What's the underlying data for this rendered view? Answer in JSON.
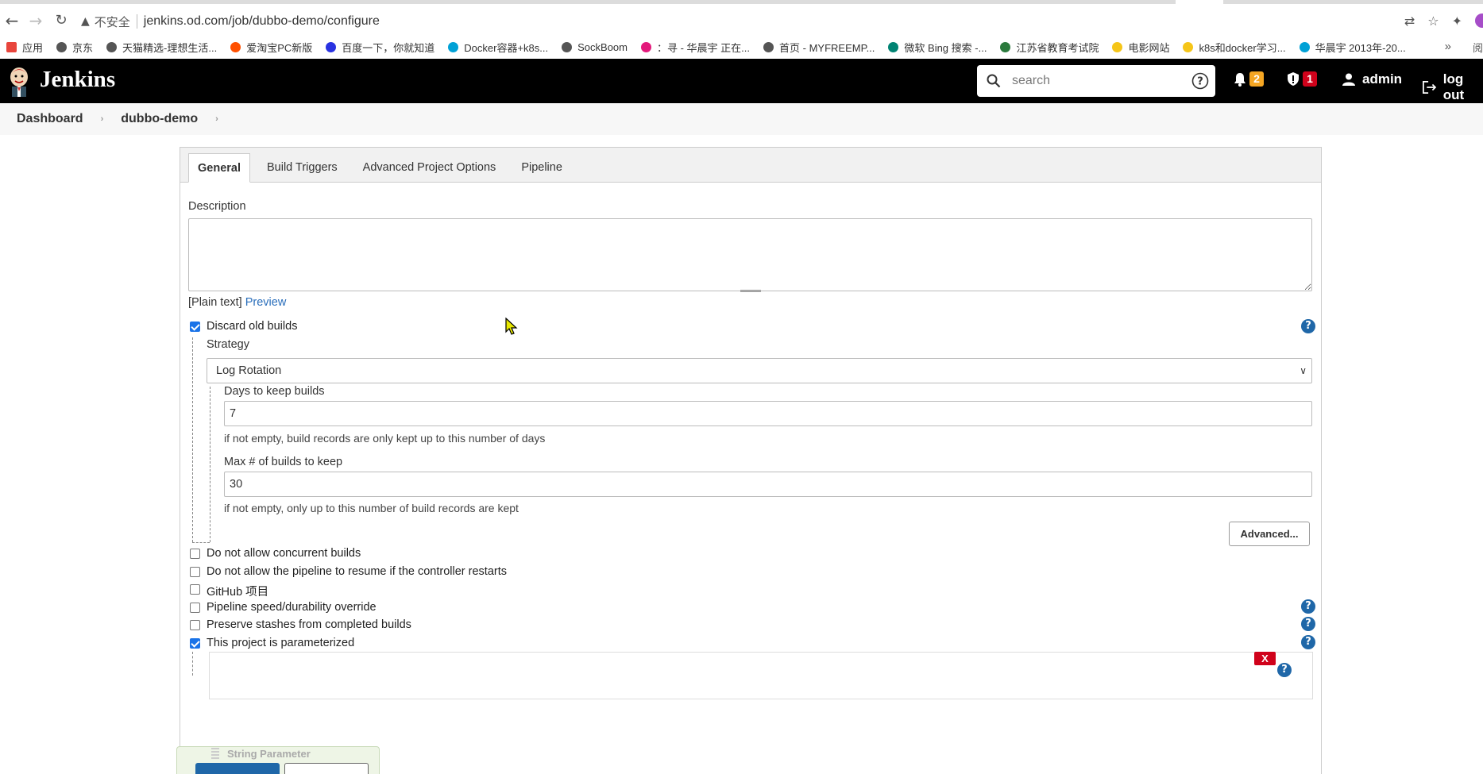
{
  "browser": {
    "url_warning": "不安全",
    "url": "jenkins.od.com/job/dubbo-demo/configure",
    "bookmarks": [
      {
        "label": "应用",
        "color": "#e8453c"
      },
      {
        "label": "京东",
        "color": "#555555"
      },
      {
        "label": "天猫精选-理想生活...",
        "color": "#555555"
      },
      {
        "label": "爱淘宝PC新版",
        "color": "#ff5000"
      },
      {
        "label": "百度一下，你就知道",
        "color": "#2932e1"
      },
      {
        "label": "Docker容器+k8s...",
        "color": "#00a1d6"
      },
      {
        "label": "SockBoom",
        "color": "#555555"
      },
      {
        "label": "：寻 - 华晨宇 正在...",
        "color": "#e3197b"
      },
      {
        "label": "首页 - MYFREEMP...",
        "color": "#555555"
      },
      {
        "label": "微软 Bing 搜索 -...",
        "color": "#008373"
      },
      {
        "label": "江苏省教育考试院",
        "color": "#2b7a3d"
      },
      {
        "label": "电影网站",
        "color": "#f5c518"
      },
      {
        "label": "k8s和docker学习...",
        "color": "#f5c518"
      },
      {
        "label": "华晨宇 2013年-20...",
        "color": "#00a1d6"
      }
    ],
    "bookmarks_more": "»",
    "reading_list": "阅"
  },
  "header": {
    "title": "Jenkins",
    "search_placeholder": "search",
    "notifications_count": "2",
    "security_count": "1",
    "user": "admin",
    "logout": "log out"
  },
  "breadcrumb": {
    "items": [
      "Dashboard",
      "dubbo-demo"
    ]
  },
  "tabs": [
    "General",
    "Build Triggers",
    "Advanced Project Options",
    "Pipeline"
  ],
  "general": {
    "description_label": "Description",
    "description_value": "",
    "plain_text": "[Plain text]",
    "preview": "Preview",
    "discard_old_builds": "Discard old builds",
    "strategy_label": "Strategy",
    "strategy_value": "Log Rotation",
    "days_label": "Days to keep builds",
    "days_value": "7",
    "days_hint": "if not empty, build records are only kept up to this number of days",
    "max_label": "Max # of builds to keep",
    "max_value": "30",
    "max_hint": "if not empty, only up to this number of build records are kept",
    "advanced": "Advanced...",
    "options": [
      {
        "label": "Do not allow concurrent builds",
        "checked": false
      },
      {
        "label": "Do not allow the pipeline to resume if the controller restarts",
        "checked": false
      },
      {
        "label": "GitHub 项目",
        "checked": false
      },
      {
        "label": "Pipeline speed/durability override",
        "checked": false
      },
      {
        "label": "Preserve stashes from completed builds",
        "checked": false
      },
      {
        "label": "This project is parameterized",
        "checked": true
      }
    ],
    "string_parameter": "String Parameter",
    "delete": "X"
  },
  "colors": {
    "header_bg": "#000000",
    "link": "#2a6ebb",
    "help": "#1f67a8",
    "notif_badge": "#f5a623",
    "security_badge": "#d0021b",
    "delete": "#d0021b"
  }
}
